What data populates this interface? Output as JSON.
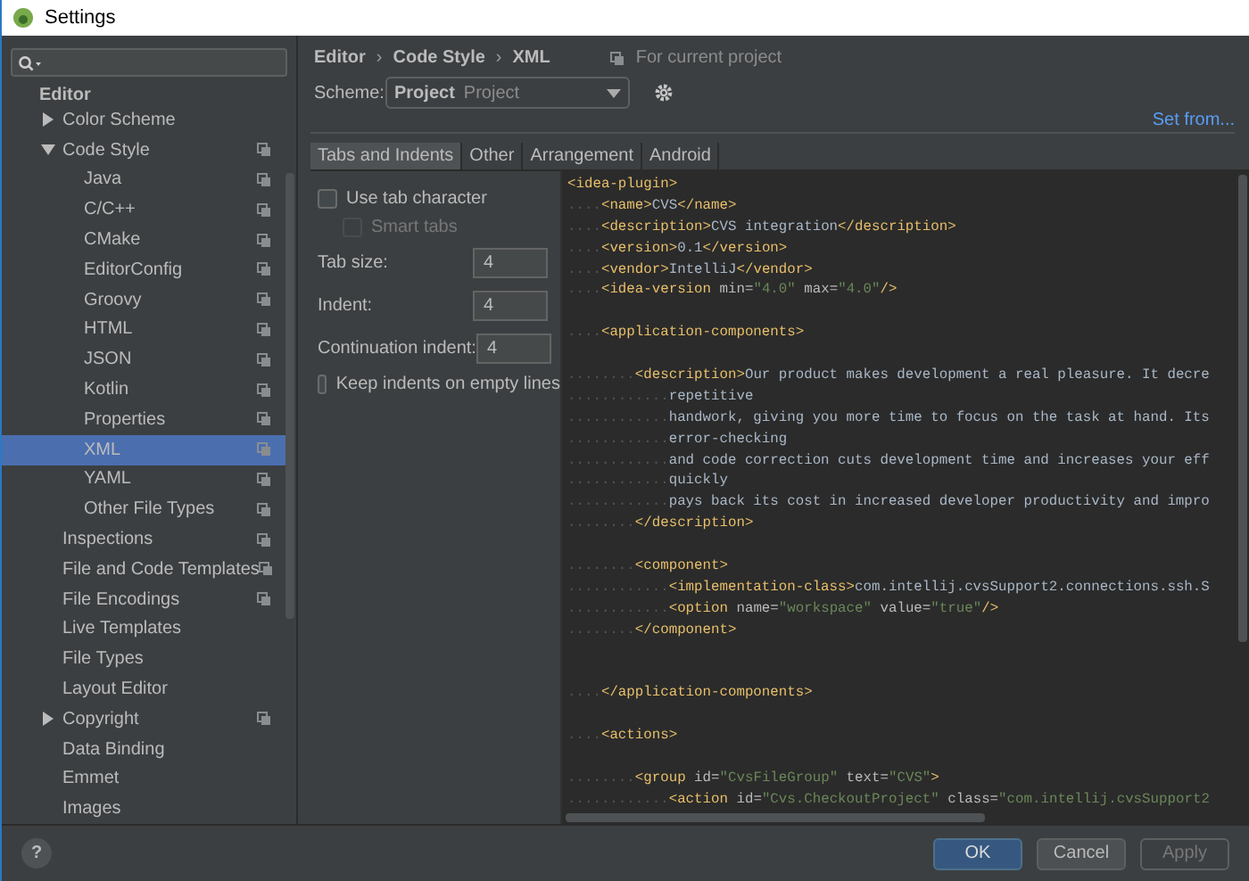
{
  "window": {
    "title": "Settings"
  },
  "sidebar": {
    "header": "Editor",
    "items": [
      {
        "label": "Color Scheme",
        "expanded": false,
        "selected": false,
        "per_project": false
      },
      {
        "label": "Code Style",
        "expanded": true,
        "selected": false,
        "per_project": true,
        "children": [
          {
            "label": "Java",
            "selected": false,
            "per_project": true
          },
          {
            "label": "C/C++",
            "selected": false,
            "per_project": true
          },
          {
            "label": "CMake",
            "selected": false,
            "per_project": true
          },
          {
            "label": "EditorConfig",
            "selected": false,
            "per_project": true
          },
          {
            "label": "Groovy",
            "selected": false,
            "per_project": true
          },
          {
            "label": "HTML",
            "selected": false,
            "per_project": true
          },
          {
            "label": "JSON",
            "selected": false,
            "per_project": true
          },
          {
            "label": "Kotlin",
            "selected": false,
            "per_project": true
          },
          {
            "label": "Properties",
            "selected": false,
            "per_project": true
          },
          {
            "label": "XML",
            "selected": true,
            "per_project": true
          },
          {
            "label": "YAML",
            "selected": false,
            "per_project": true
          },
          {
            "label": "Other File Types",
            "selected": false,
            "per_project": true
          }
        ]
      },
      {
        "label": "Inspections",
        "selected": false,
        "per_project": true
      },
      {
        "label": "File and Code Templates",
        "selected": false,
        "per_project": true
      },
      {
        "label": "File Encodings",
        "selected": false,
        "per_project": true
      },
      {
        "label": "Live Templates",
        "selected": false,
        "per_project": false
      },
      {
        "label": "File Types",
        "selected": false,
        "per_project": false
      },
      {
        "label": "Layout Editor",
        "selected": false,
        "per_project": false
      },
      {
        "label": "Copyright",
        "expanded": false,
        "selected": false,
        "per_project": true
      },
      {
        "label": "Data Binding",
        "selected": false,
        "per_project": false
      },
      {
        "label": "Emmet",
        "selected": false,
        "per_project": false
      },
      {
        "label": "Images",
        "selected": false,
        "per_project": false
      }
    ]
  },
  "breadcrumb": [
    "Editor",
    "Code Style",
    "XML"
  ],
  "breadcrumb_separator": "›",
  "scope_note": "For current project",
  "scheme": {
    "label": "Scheme:",
    "name": "Project",
    "kind": "Project"
  },
  "set_from": "Set from...",
  "tabs": [
    {
      "label": "Tabs and Indents",
      "selected": true
    },
    {
      "label": "Other",
      "selected": false
    },
    {
      "label": "Arrangement",
      "selected": false
    },
    {
      "label": "Android",
      "selected": false
    }
  ],
  "options": [
    {
      "kind": "checkbox",
      "label": "Use tab character",
      "checked": false,
      "disabled": false,
      "nested": false
    },
    {
      "kind": "checkbox",
      "label": "Smart tabs",
      "checked": false,
      "disabled": true,
      "nested": true
    },
    {
      "kind": "number",
      "label": "Tab size:",
      "value": "4"
    },
    {
      "kind": "number",
      "label": "Indent:",
      "value": "4"
    },
    {
      "kind": "number",
      "label": "Continuation indent:",
      "value": "4"
    },
    {
      "kind": "checkbox",
      "label": "Keep indents on empty lines",
      "checked": false,
      "disabled": false,
      "nested": false
    }
  ],
  "code": [
    {
      "tokens": [
        {
          "kind": "tag",
          "text": "<idea-plugin>"
        }
      ]
    },
    {
      "indent": "....",
      "tokens": [
        {
          "kind": "tag",
          "text": "<name>"
        },
        {
          "kind": "text",
          "text": "CVS"
        },
        {
          "kind": "tag",
          "text": "</name>"
        }
      ]
    },
    {
      "indent": "....",
      "tokens": [
        {
          "kind": "tag",
          "text": "<description>"
        },
        {
          "kind": "text",
          "text": "CVS integration"
        },
        {
          "kind": "tag",
          "text": "</description>"
        }
      ]
    },
    {
      "indent": "....",
      "tokens": [
        {
          "kind": "tag",
          "text": "<version>"
        },
        {
          "kind": "text",
          "text": "0.1"
        },
        {
          "kind": "tag",
          "text": "</version>"
        }
      ]
    },
    {
      "indent": "....",
      "tokens": [
        {
          "kind": "tag",
          "text": "<vendor>"
        },
        {
          "kind": "text",
          "text": "IntelliJ"
        },
        {
          "kind": "tag",
          "text": "</vendor>"
        }
      ]
    },
    {
      "indent": "....",
      "tokens": [
        {
          "kind": "tag",
          "text": "<idea-version "
        },
        {
          "kind": "attr",
          "text": "min="
        },
        {
          "kind": "value",
          "text": "\"4.0\""
        },
        {
          "kind": "attr",
          "text": " max="
        },
        {
          "kind": "value",
          "text": "\"4.0\""
        },
        {
          "kind": "tag",
          "text": "/>"
        }
      ]
    },
    {
      "kind": "blank"
    },
    {
      "indent": "....",
      "tokens": [
        {
          "kind": "tag",
          "text": "<application-components>"
        }
      ]
    },
    {
      "kind": "blank"
    },
    {
      "indent": "........",
      "tokens": [
        {
          "kind": "tag",
          "text": "<description>"
        },
        {
          "kind": "text",
          "text": "Our product makes development a real pleasure. It decre"
        }
      ]
    },
    {
      "indent": "............",
      "tokens": [
        {
          "kind": "text",
          "text": "repetitive"
        }
      ]
    },
    {
      "indent": "............",
      "tokens": [
        {
          "kind": "text",
          "text": "handwork, giving you more time to focus on the task at hand. Its"
        }
      ]
    },
    {
      "indent": "............",
      "tokens": [
        {
          "kind": "text",
          "text": "error-checking"
        }
      ]
    },
    {
      "indent": "............",
      "tokens": [
        {
          "kind": "text",
          "text": "and code correction cuts development time and increases your eff"
        }
      ]
    },
    {
      "indent": "............",
      "tokens": [
        {
          "kind": "text",
          "text": "quickly"
        }
      ]
    },
    {
      "indent": "............",
      "tokens": [
        {
          "kind": "text",
          "text": "pays back its cost in increased developer productivity and impro"
        }
      ]
    },
    {
      "indent": "........",
      "tokens": [
        {
          "kind": "tag",
          "text": "</description>"
        }
      ]
    },
    {
      "kind": "blank"
    },
    {
      "indent": "........",
      "tokens": [
        {
          "kind": "tag",
          "text": "<component>"
        }
      ]
    },
    {
      "indent": "............",
      "tokens": [
        {
          "kind": "tag",
          "text": "<implementation-class>"
        },
        {
          "kind": "text",
          "text": "com.intellij.cvsSupport2.connections.ssh.S"
        }
      ]
    },
    {
      "indent": "............",
      "tokens": [
        {
          "kind": "tag",
          "text": "<option "
        },
        {
          "kind": "attr",
          "text": "name="
        },
        {
          "kind": "value",
          "text": "\"workspace\""
        },
        {
          "kind": "attr",
          "text": " value="
        },
        {
          "kind": "value",
          "text": "\"true\""
        },
        {
          "kind": "tag",
          "text": "/>"
        }
      ]
    },
    {
      "indent": "........",
      "tokens": [
        {
          "kind": "tag",
          "text": "</component>"
        }
      ]
    },
    {
      "kind": "blank"
    },
    {
      "kind": "blank"
    },
    {
      "indent": "....",
      "tokens": [
        {
          "kind": "tag",
          "text": "</application-components>"
        }
      ]
    },
    {
      "kind": "blank"
    },
    {
      "indent": "....",
      "tokens": [
        {
          "kind": "tag",
          "text": "<actions>"
        }
      ]
    },
    {
      "kind": "blank"
    },
    {
      "indent": "........",
      "tokens": [
        {
          "kind": "tag",
          "text": "<group "
        },
        {
          "kind": "attr",
          "text": "id="
        },
        {
          "kind": "value",
          "text": "\"CvsFileGroup\""
        },
        {
          "kind": "attr",
          "text": " text="
        },
        {
          "kind": "value",
          "text": "\"CVS\""
        },
        {
          "kind": "tag",
          "text": ">"
        }
      ]
    },
    {
      "indent": "............",
      "tokens": [
        {
          "kind": "tag",
          "text": "<action "
        },
        {
          "kind": "attr",
          "text": "id="
        },
        {
          "kind": "value",
          "text": "\"Cvs.CheckoutProject\""
        },
        {
          "kind": "attr",
          "text": " class="
        },
        {
          "kind": "value",
          "text": "\"com.intellij.cvsSupport2"
        }
      ]
    }
  ],
  "help": "?",
  "buttons": [
    {
      "label": "OK",
      "kind": "primary",
      "disabled": false
    },
    {
      "label": "Cancel",
      "kind": "normal",
      "disabled": false
    },
    {
      "label": "Apply",
      "kind": "normal",
      "disabled": true
    }
  ]
}
